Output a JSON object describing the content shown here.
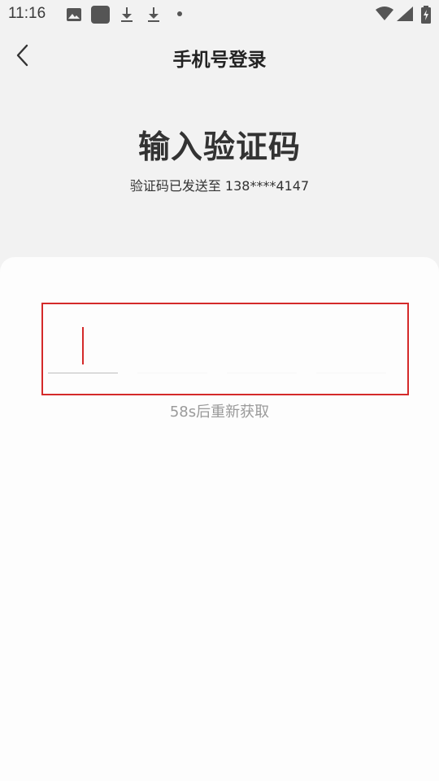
{
  "status_bar": {
    "time": "11:16",
    "icons": [
      "image-icon",
      "app-square-icon",
      "download-icon",
      "download-icon",
      "dot-icon",
      "wifi-icon",
      "signal-icon",
      "battery-icon"
    ]
  },
  "header": {
    "back_icon": "chevron-left-icon",
    "title": "手机号登录"
  },
  "verification": {
    "title": "输入验证码",
    "subtitle": "验证码已发送至 138****4147",
    "code_length": 4,
    "code_values": [
      "",
      "",
      "",
      ""
    ],
    "resend_text": "58s后重新获取"
  },
  "colors": {
    "accent": "#d42a2a",
    "background": "#f2f2f2",
    "card": "#fdfdfd",
    "muted_text": "#9a9a9a"
  }
}
